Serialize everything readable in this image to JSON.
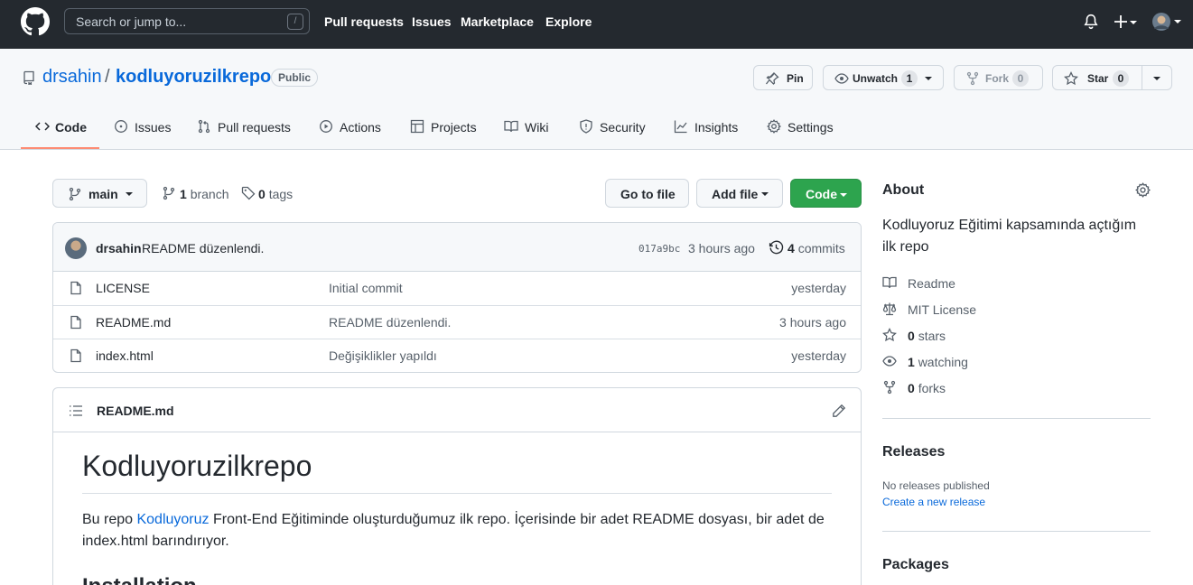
{
  "header": {
    "search_placeholder": "Search or jump to...",
    "slash_key": "/",
    "nav": [
      "Pull requests",
      "Issues",
      "Marketplace",
      "Explore"
    ]
  },
  "repo": {
    "owner": "drsahin",
    "separator": "/",
    "name": "kodluyoruzilkrepo",
    "visibility": "Public",
    "actions": {
      "pin": "Pin",
      "unwatch": "Unwatch",
      "watch_count": "1",
      "fork": "Fork",
      "fork_count": "0",
      "star": "Star",
      "star_count": "0"
    },
    "tabs": [
      "Code",
      "Issues",
      "Pull requests",
      "Actions",
      "Projects",
      "Wiki",
      "Security",
      "Insights",
      "Settings"
    ]
  },
  "filenav": {
    "branch": "main",
    "branch_count": "1",
    "branch_label": "branch",
    "tag_count": "0",
    "tag_label": "tags",
    "go_to_file": "Go to file",
    "add_file": "Add file",
    "code": "Code"
  },
  "commit": {
    "author": "drsahin",
    "message": "README düzenlendi.",
    "sha": "017a9bc",
    "age": "3 hours ago",
    "commit_count": "4",
    "commit_label": "commits"
  },
  "files": [
    {
      "name": "LICENSE",
      "message": "Initial commit",
      "age": "yesterday"
    },
    {
      "name": "README.md",
      "message": "README düzenlendi.",
      "age": "3 hours ago"
    },
    {
      "name": "index.html",
      "message": "Değişiklikler yapıldı",
      "age": "yesterday"
    }
  ],
  "readme": {
    "filename": "README.md",
    "title": "Kodluyoruzilkrepo",
    "para_before": "Bu repo ",
    "para_link": "Kodluyoruz",
    "para_after": " Front-End Eğitiminde oluşturduğumuz ilk repo. İçerisinde bir adet README dosyası, bir adet de index.html barındırıyor.",
    "next_heading": "Installation"
  },
  "about": {
    "title": "About",
    "description": "Kodluyoruz Eğitimi kapsamında açtığım ilk repo",
    "readme": "Readme",
    "license": "MIT License",
    "stars_count": "0",
    "stars_label": "stars",
    "watching_count": "1",
    "watching_label": "watching",
    "forks_count": "0",
    "forks_label": "forks"
  },
  "releases": {
    "title": "Releases",
    "none": "No releases published",
    "create": "Create a new release"
  },
  "packages": {
    "title": "Packages"
  },
  "colors": {
    "header_bg": "#24292f",
    "link": "#0969da",
    "primary_button": "#2da44e",
    "tab_underline": "#fd8c73"
  }
}
